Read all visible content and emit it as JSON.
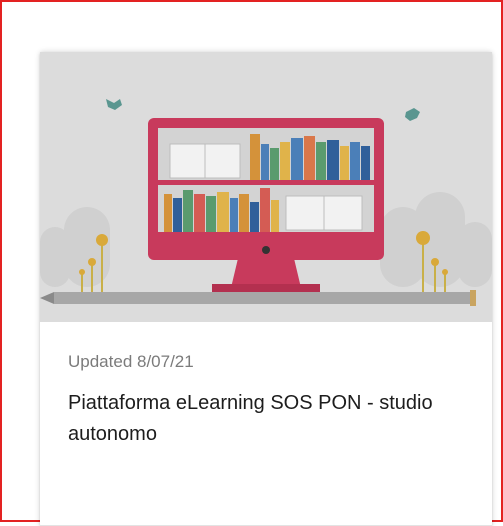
{
  "card": {
    "updated_text": "Updated 8/07/21",
    "title": "Piattaforma eLearning SOS PON - studio autonomo",
    "thumbnail_icon": "elearning-monitor-bookshelf-illustration"
  },
  "colors": {
    "frame_border": "#e32222",
    "thumbnail_bg": "#dcdcdc",
    "monitor": "#c83a5c"
  }
}
